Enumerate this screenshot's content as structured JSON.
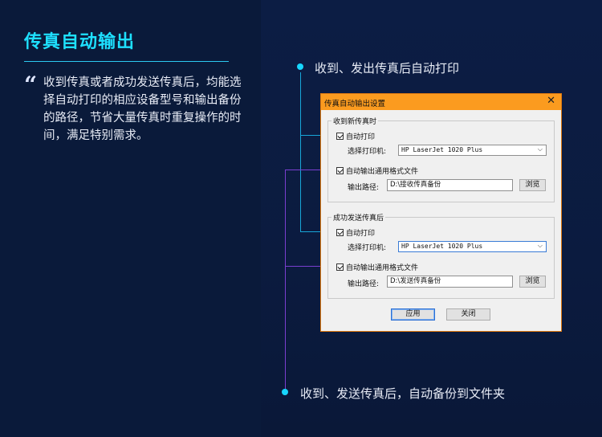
{
  "left": {
    "title": "传真自动输出",
    "quote": "“",
    "description": "收到传真或者成功发送传真后，均能选择自动打印的相应设备型号和输出备份的路径，节省大量传真时重复操作的时间，满足特别需求。"
  },
  "bullets": {
    "top": "收到、发出传真后自动打印",
    "bottom": "收到、发送传真后，自动备份到文件夹"
  },
  "dialog": {
    "title": "传真自动输出设置",
    "close": "✕",
    "received": {
      "group_label": "收到新传真时",
      "auto_print_label": "自动打印",
      "printer_label": "选择打印机:",
      "printer_value": "HP LaserJet 1020 Plus",
      "auto_output_label": "自动输出通用格式文件",
      "path_label": "输出路径:",
      "path_value": "D:\\接收传真备份",
      "browse_label": "浏览"
    },
    "sent": {
      "group_label": "成功发送传真后",
      "auto_print_label": "自动打印",
      "printer_label": "选择打印机:",
      "printer_value": "HP LaserJet 1020 Plus",
      "auto_output_label": "自动输出通用格式文件",
      "path_label": "输出路径:",
      "path_value": "D:\\发送传真备份",
      "browse_label": "浏览"
    },
    "apply_label": "应用",
    "close_label": "关闭"
  },
  "colors": {
    "accent": "#1ee0ff",
    "connector_cyan": "#18a6d8",
    "connector_purple": "#7a3ed0",
    "dialog_titlebar": "#fb9b1f"
  }
}
